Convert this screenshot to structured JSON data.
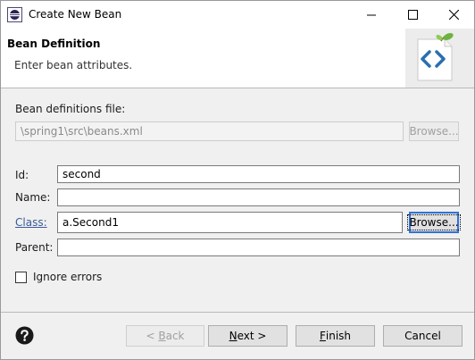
{
  "window": {
    "title": "Create New Bean",
    "app_icon": "eclipse-icon"
  },
  "header": {
    "title": "Bean Definition",
    "description": "Enter bean attributes.",
    "image": "bean-wizard-icon"
  },
  "form": {
    "bean_file_label": "Bean definitions file:",
    "bean_file_value": "\\spring1\\src\\beans.xml",
    "bean_file_browse": "Browse...",
    "id_label": "Id:",
    "id_value": "second",
    "name_label": "Name:",
    "name_value": "",
    "class_label": "Class:",
    "class_value": "a.Second1",
    "class_browse": "Browse...",
    "parent_label": "Parent:",
    "parent_value": "",
    "ignore_errors_label": "Ignore errors",
    "ignore_errors_checked": false
  },
  "footer": {
    "help_icon": "help-icon",
    "back_prefix": "< ",
    "back_mnemonic": "B",
    "back_rest": "ack",
    "next_mnemonic": "N",
    "next_rest": "ext >",
    "finish_mnemonic": "F",
    "finish_rest": "inish",
    "cancel": "Cancel"
  }
}
